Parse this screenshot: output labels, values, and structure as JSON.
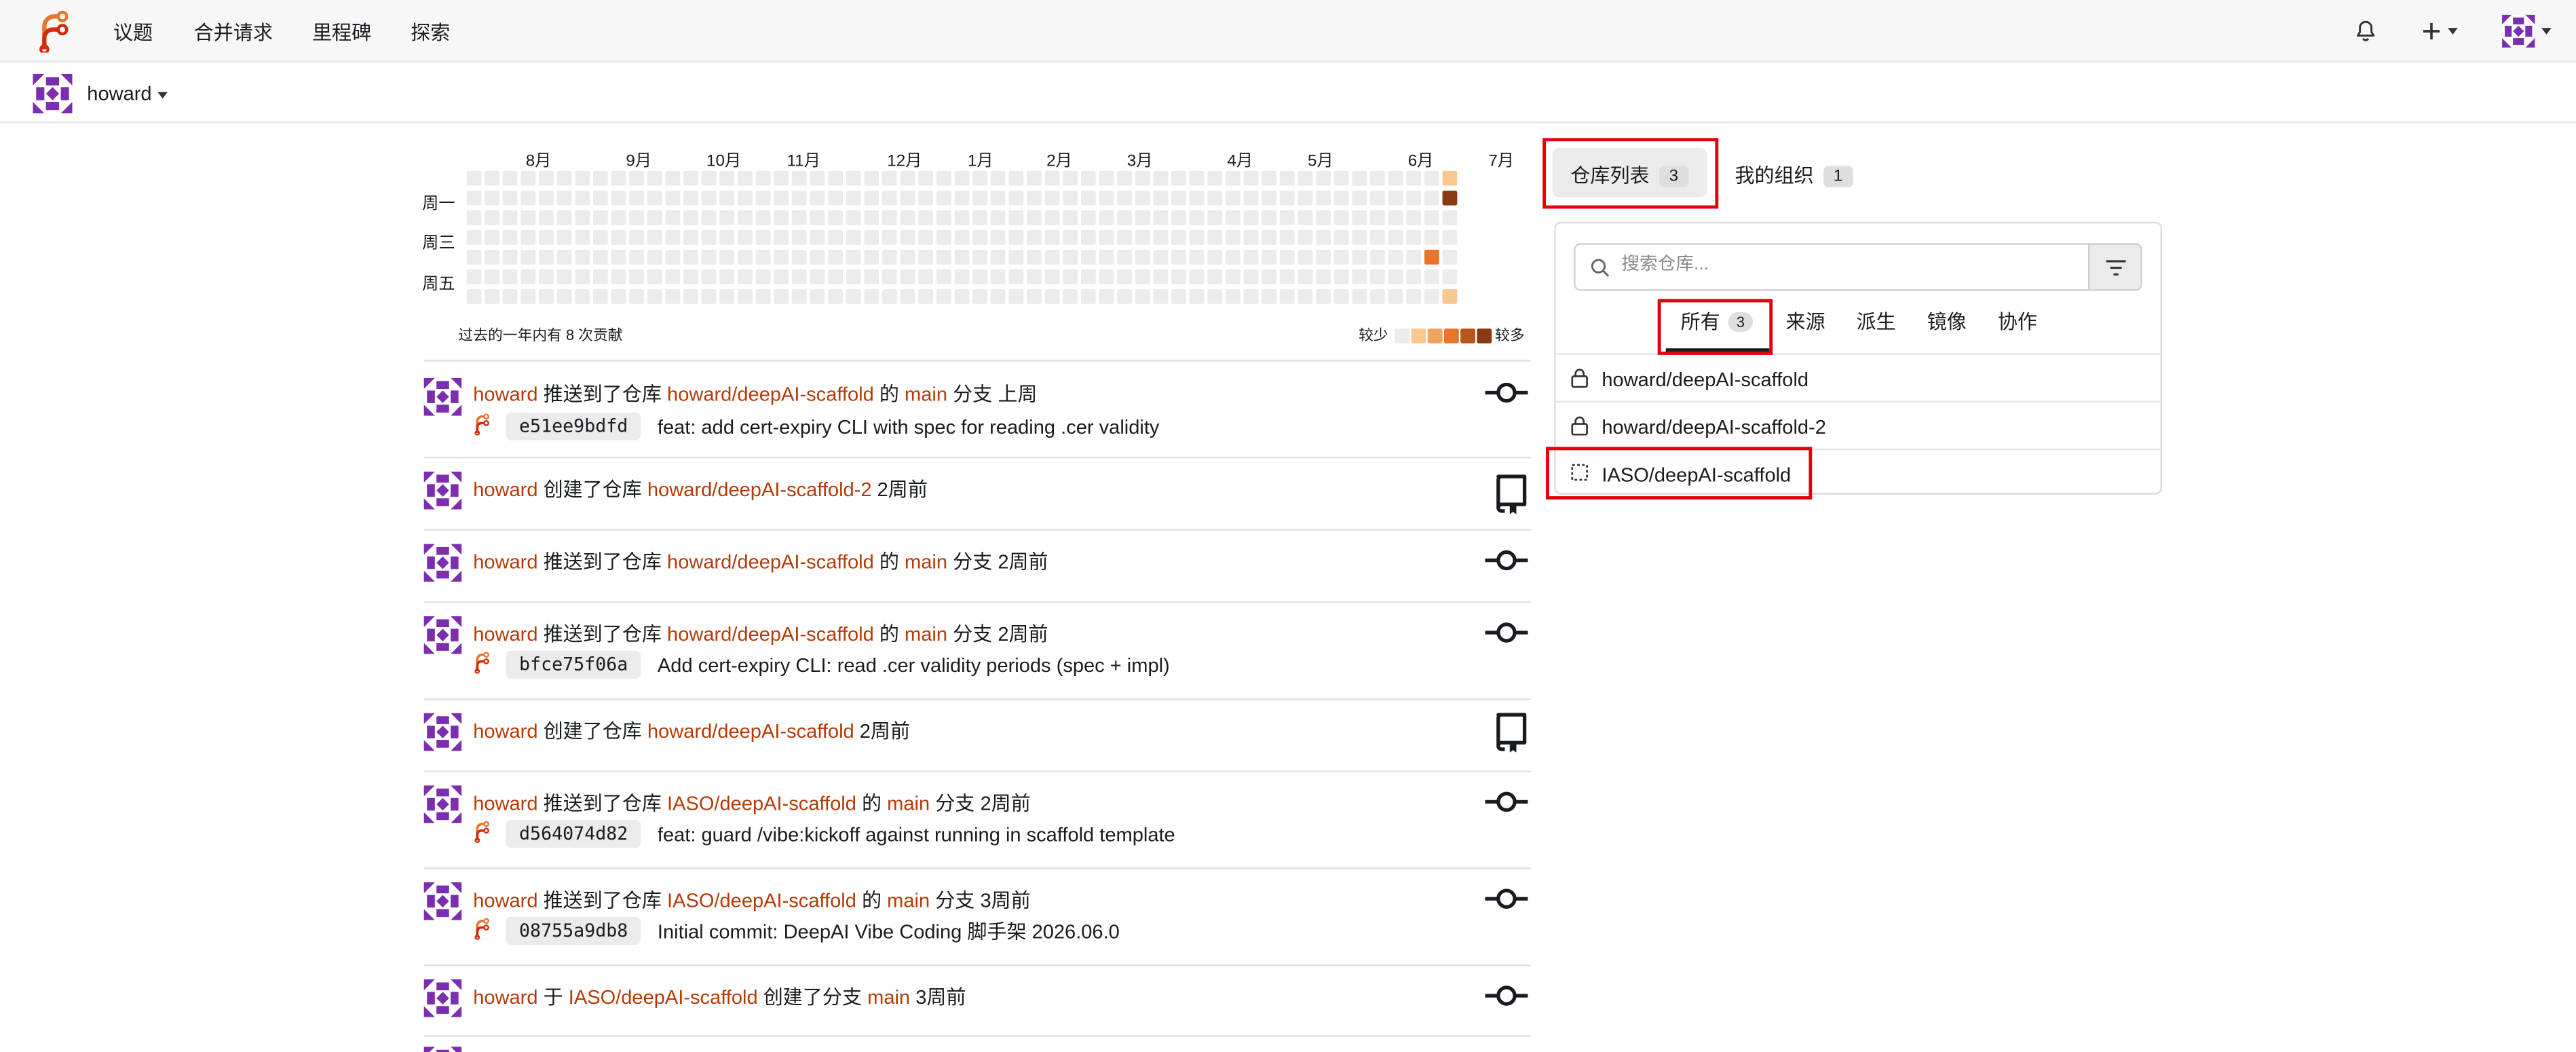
{
  "nav": {
    "issues": "议题",
    "pulls": "合并请求",
    "milestones": "里程碑",
    "explore": "探索"
  },
  "user": {
    "name": "howard"
  },
  "heatmap": {
    "months": [
      "8月",
      "9月",
      "10月",
      "11月",
      "12月",
      "1月",
      "2月",
      "3月",
      "4月",
      "5月",
      "6月",
      "7月"
    ],
    "day_labels": [
      "周一",
      "周三",
      "周五"
    ],
    "summary": "过去的一年内有 8 次贡献",
    "less": "较少",
    "more": "较多",
    "legend_colors": [
      "#ebebeb",
      "#f8c98f",
      "#f2a35e",
      "#e8762a",
      "#b8551b",
      "#8a3a12"
    ]
  },
  "feed": [
    {
      "user": "howard",
      "verb": "推送到了仓库",
      "repo": "howard/deepAI-scaffold",
      "mid": "的",
      "branch": "main",
      "tail": "分支",
      "time": "上周",
      "sha": "e51ee9bdfd",
      "message": "feat: add cert-expiry CLI with spec for reading .cer validity",
      "icon": "commit-icon"
    },
    {
      "user": "howard",
      "verb": "创建了仓库",
      "repo": "howard/deepAI-scaffold-2",
      "time": "2周前",
      "icon": "repo-icon"
    },
    {
      "user": "howard",
      "verb": "推送到了仓库",
      "repo": "howard/deepAI-scaffold",
      "mid": "的",
      "branch": "main",
      "tail": "分支",
      "time": "2周前",
      "icon": "commit-icon"
    },
    {
      "user": "howard",
      "verb": "推送到了仓库",
      "repo": "howard/deepAI-scaffold",
      "mid": "的",
      "branch": "main",
      "tail": "分支",
      "time": "2周前",
      "sha": "bfce75f06a",
      "message": "Add cert-expiry CLI: read .cer validity periods (spec + impl)",
      "icon": "commit-icon"
    },
    {
      "user": "howard",
      "verb": "创建了仓库",
      "repo": "howard/deepAI-scaffold",
      "time": "2周前",
      "icon": "repo-icon"
    },
    {
      "user": "howard",
      "verb": "推送到了仓库",
      "repo": "IASO/deepAI-scaffold",
      "mid": "的",
      "branch": "main",
      "tail": "分支",
      "time": "2周前",
      "sha": "d564074d82",
      "message": "feat: guard /vibe:kickoff against running in scaffold template",
      "icon": "commit-icon"
    },
    {
      "user": "howard",
      "verb": "推送到了仓库",
      "repo": "IASO/deepAI-scaffold",
      "mid": "的",
      "branch": "main",
      "tail": "分支",
      "time": "3周前",
      "sha": "08755a9db8",
      "message": "Initial commit: DeepAI Vibe Coding 脚手架 2026.06.0",
      "icon": "commit-icon"
    },
    {
      "user": "howard",
      "verb": "于",
      "repo": "IASO/deepAI-scaffold",
      "mid": "创建了分支",
      "branch": "main",
      "time": "3周前",
      "icon": "commit-icon"
    }
  ],
  "tabs": {
    "repos": "仓库列表",
    "repos_count": "3",
    "orgs": "我的组织",
    "orgs_count": "1"
  },
  "repo_search": {
    "placeholder": "搜索仓库..."
  },
  "repo_filters": [
    {
      "label": "所有",
      "count": "3"
    },
    {
      "label": "来源"
    },
    {
      "label": "派生"
    },
    {
      "label": "镜像"
    },
    {
      "label": "协作"
    }
  ],
  "repos": [
    {
      "name": "howard/deepAI-scaffold",
      "icon": "lock-icon"
    },
    {
      "name": "howard/deepAI-scaffold-2",
      "icon": "lock-icon"
    },
    {
      "name": "IASO/deepAI-scaffold",
      "icon": "template-repo-icon"
    }
  ]
}
